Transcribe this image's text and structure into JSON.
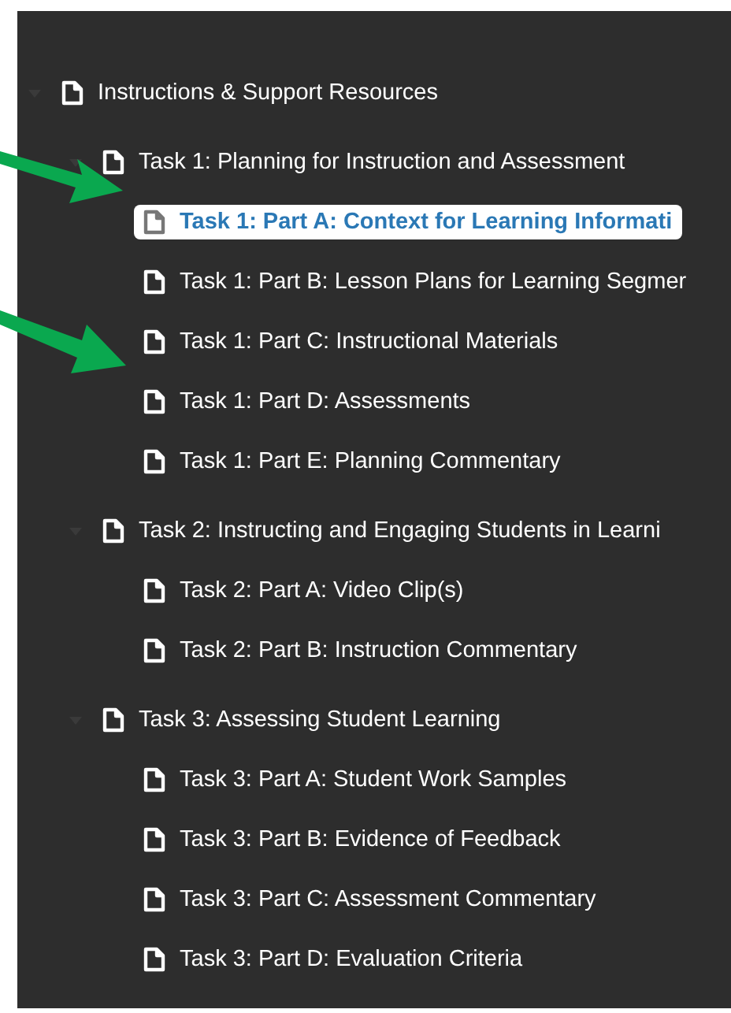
{
  "tree": [
    {
      "label": "Instructions & Support Resources",
      "expanded": true,
      "selected": false,
      "children": [
        {
          "label": "Task 1: Planning for Instruction and Assessment",
          "expanded": true,
          "selected": false,
          "children": [
            {
              "label": "Task 1: Part A: Context for Learning Informati",
              "selected": true
            },
            {
              "label": "Task 1: Part B: Lesson Plans for Learning Segmer",
              "selected": false
            },
            {
              "label": "Task 1: Part C: Instructional Materials",
              "selected": false
            },
            {
              "label": "Task 1: Part D: Assessments",
              "selected": false
            },
            {
              "label": "Task 1: Part E: Planning Commentary",
              "selected": false
            }
          ]
        },
        {
          "label": "Task 2: Instructing and Engaging Students in Learni",
          "expanded": true,
          "selected": false,
          "children": [
            {
              "label": "Task 2: Part A: Video Clip(s)",
              "selected": false
            },
            {
              "label": "Task 2: Part B: Instruction Commentary",
              "selected": false
            }
          ]
        },
        {
          "label": "Task 3: Assessing Student Learning",
          "expanded": true,
          "selected": false,
          "children": [
            {
              "label": "Task 3: Part A: Student Work Samples",
              "selected": false
            },
            {
              "label": "Task 3: Part B: Evidence of Feedback",
              "selected": false
            },
            {
              "label": "Task 3: Part C: Assessment Commentary",
              "selected": false
            },
            {
              "label": "Task 3: Part D: Evaluation Criteria",
              "selected": false
            }
          ]
        }
      ]
    }
  ]
}
